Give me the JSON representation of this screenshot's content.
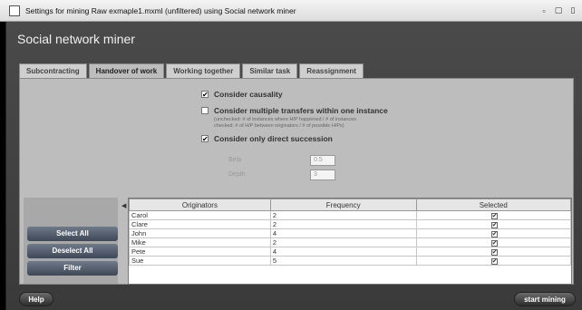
{
  "window": {
    "title": "Settings for mining Raw exmaple1.mxml (unfiltered) using Social network miner",
    "minimize": "▫",
    "maximize": "▢",
    "close": "▯"
  },
  "app": {
    "title": "Social network miner"
  },
  "tabs": [
    {
      "label": "Subcontracting"
    },
    {
      "label": "Handover of work"
    },
    {
      "label": "Working together"
    },
    {
      "label": "Similar task"
    },
    {
      "label": "Reassignment"
    }
  ],
  "options": {
    "causality": {
      "label": "Consider causality",
      "checked": "✔"
    },
    "multiple": {
      "label": "Consider multiple transfers within one instance",
      "checked": "",
      "note1": "(unchecked: # of instances where H/P happened / # of instances",
      "note2": "checked: # of H/P between originators / # of possible H/Ps)"
    },
    "direct": {
      "label": "Consider only direct succession",
      "checked": "✔"
    },
    "beta_label": "Beta",
    "beta_value": "0.5",
    "depth_label": "Depth",
    "depth_value": "3"
  },
  "buttons": {
    "select_all": "Select All",
    "deselect_all": "Deselect All",
    "filter": "Filter",
    "help": "Help",
    "start": "start mining"
  },
  "table": {
    "headers": [
      "Originators",
      "Frequency",
      "Selected"
    ],
    "rows": [
      {
        "name": "Carol",
        "freq": "2",
        "sel": "✔"
      },
      {
        "name": "Clare",
        "freq": "2",
        "sel": "✔"
      },
      {
        "name": "John",
        "freq": "4",
        "sel": "✔"
      },
      {
        "name": "Mike",
        "freq": "2",
        "sel": "✔"
      },
      {
        "name": "Pete",
        "freq": "4",
        "sel": "✔"
      },
      {
        "name": "Sue",
        "freq": "5",
        "sel": "✔"
      }
    ]
  }
}
